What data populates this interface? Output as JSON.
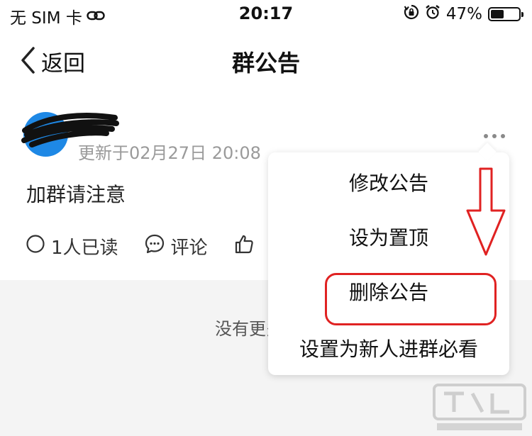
{
  "status_bar": {
    "carrier": "无 SIM 卡",
    "time": "20:17",
    "battery": "47%",
    "battery_level": 0.47
  },
  "nav": {
    "back_label": "返回",
    "title": "群公告"
  },
  "post": {
    "updated": "更新于02月27日 20:08",
    "content": "加群请注意",
    "read_count": "1人已读",
    "comment_label": "评论"
  },
  "menu": {
    "items": [
      "修改公告",
      "设为置顶",
      "删除公告",
      "设置为新人进群必看"
    ]
  },
  "list_footer": {
    "no_more": "没有更多了"
  },
  "colors": {
    "accent": "#1e88e5",
    "highlight": "#e02222",
    "muted": "#9a9a9a",
    "background_gray": "#f4f4f4"
  }
}
